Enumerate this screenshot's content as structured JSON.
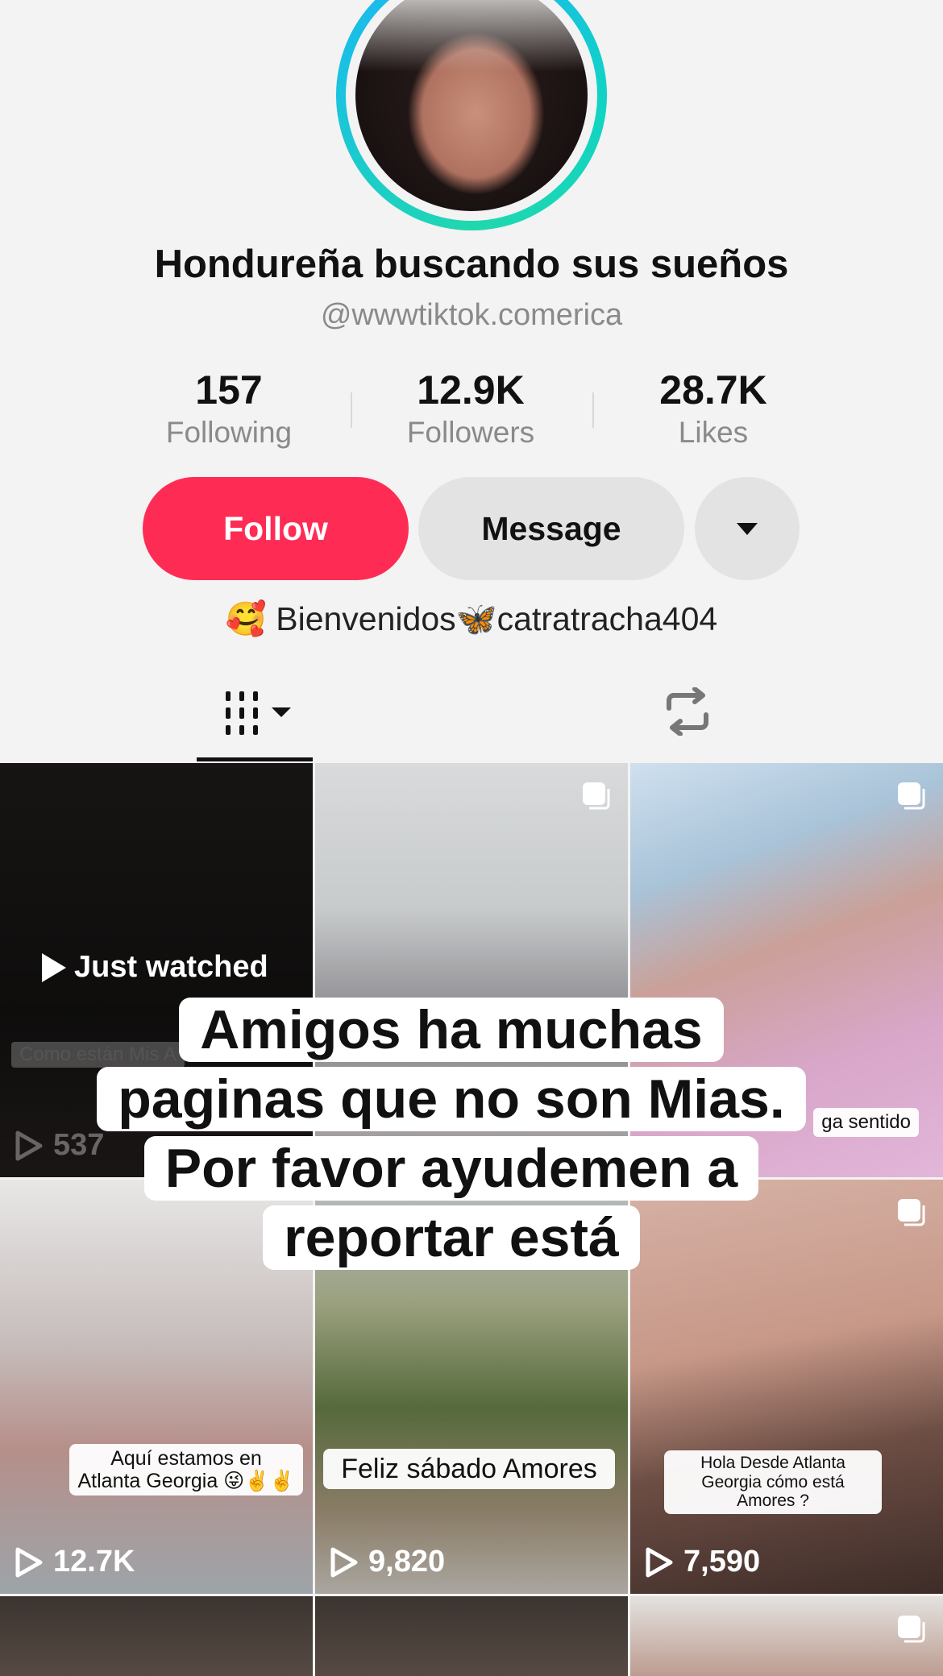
{
  "profile": {
    "display_name": "Hondureña buscando sus sueños",
    "username": "@wwwtiktok.comerica",
    "bio": "🥰 Bienvenidos🦋catratracha404"
  },
  "stats": [
    {
      "value": "157",
      "label": "Following"
    },
    {
      "value": "12.9K",
      "label": "Followers"
    },
    {
      "value": "28.7K",
      "label": "Likes"
    }
  ],
  "actions": {
    "follow_label": "Follow",
    "message_label": "Message"
  },
  "tabs": {
    "videos_icon": "grid-icon",
    "reposts_icon": "repost-icon"
  },
  "videos": [
    {
      "caption": "Como están Mis A",
      "views": "537",
      "badge": "Just watched"
    },
    {
      "caption": "",
      "views": ""
    },
    {
      "caption": "ga sentido",
      "views": ""
    },
    {
      "caption": "Aquí estamos en Atlanta Georgia 😜✌️✌️",
      "views": "12.7K"
    },
    {
      "caption": "Feliz sábado Amores",
      "views": "9,820"
    },
    {
      "caption": "Hola Desde Atlanta Georgia cómo está Amores ?",
      "views": "7,590"
    }
  ],
  "overlay": {
    "lines": [
      "Amigos ha muchas",
      "paginas que no son Mias.",
      "Por favor ayudemen a",
      "reportar está"
    ]
  },
  "colors": {
    "follow": "#fe2c55",
    "ring_start": "#1ab5f3",
    "ring_end": "#20d8ae"
  }
}
